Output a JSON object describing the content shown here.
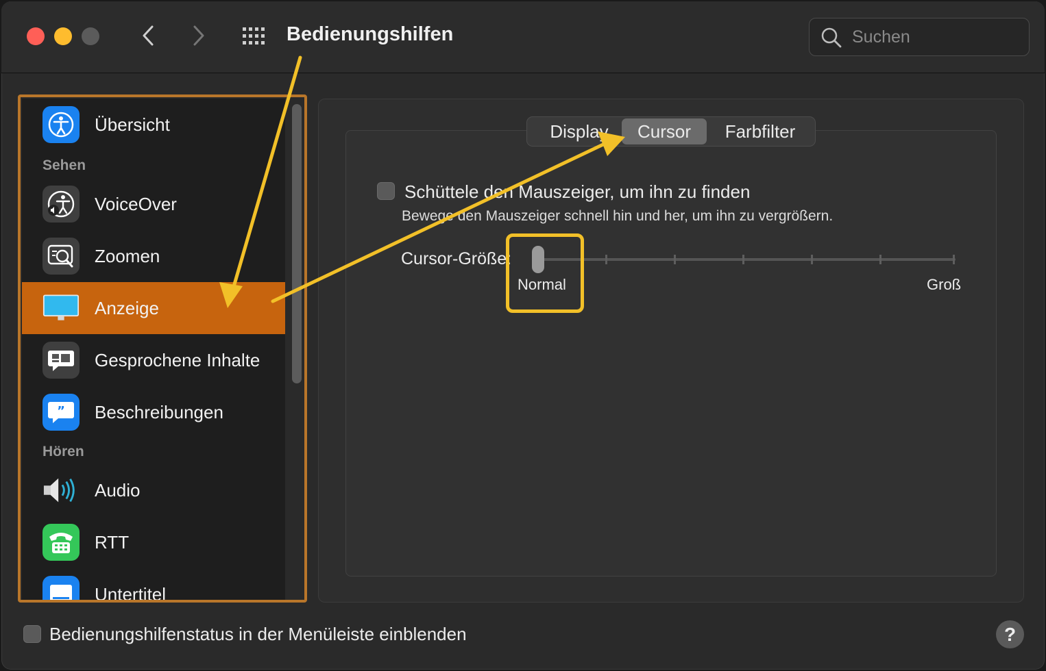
{
  "window": {
    "title": "Bedienungshilfen",
    "search_placeholder": "Suchen"
  },
  "sidebar": {
    "items": [
      {
        "label": "Übersicht",
        "icon": "accessibility-icon"
      },
      {
        "label": "VoiceOver",
        "icon": "voiceover-icon"
      },
      {
        "label": "Zoomen",
        "icon": "zoom-icon"
      },
      {
        "label": "Anzeige",
        "icon": "display-icon",
        "selected": true
      },
      {
        "label": "Gesprochene Inhalte",
        "icon": "spoken-content-icon"
      },
      {
        "label": "Beschreibungen",
        "icon": "descriptions-icon"
      },
      {
        "label": "Audio",
        "icon": "speaker-icon"
      },
      {
        "label": "RTT",
        "icon": "rtt-phone-icon"
      },
      {
        "label": "Untertitel",
        "icon": "captions-icon"
      }
    ],
    "sections": {
      "see": "Sehen",
      "hear": "Hören"
    }
  },
  "tabs": {
    "display": "Display",
    "cursor": "Cursor",
    "color_filter": "Farbfilter",
    "selected": "Cursor"
  },
  "cursor": {
    "shake_label": "Schüttele den Mauszeiger, um ihn zu finden",
    "shake_description": "Bewege den Mauszeiger schnell hin und her, um ihn zu vergrößern.",
    "shake_checked": false,
    "size_label": "Cursor-Größe:",
    "size_min_label": "Normal",
    "size_max_label": "Groß",
    "size_value": 0
  },
  "footer": {
    "menubar_status_label": "Bedienungshilfenstatus in der Menüleiste einblenden",
    "menubar_status_checked": false,
    "help": "?"
  },
  "colors": {
    "selection": "#c7640e",
    "annotation": "#f2c028",
    "sidebar_frame": "#b9762a"
  }
}
